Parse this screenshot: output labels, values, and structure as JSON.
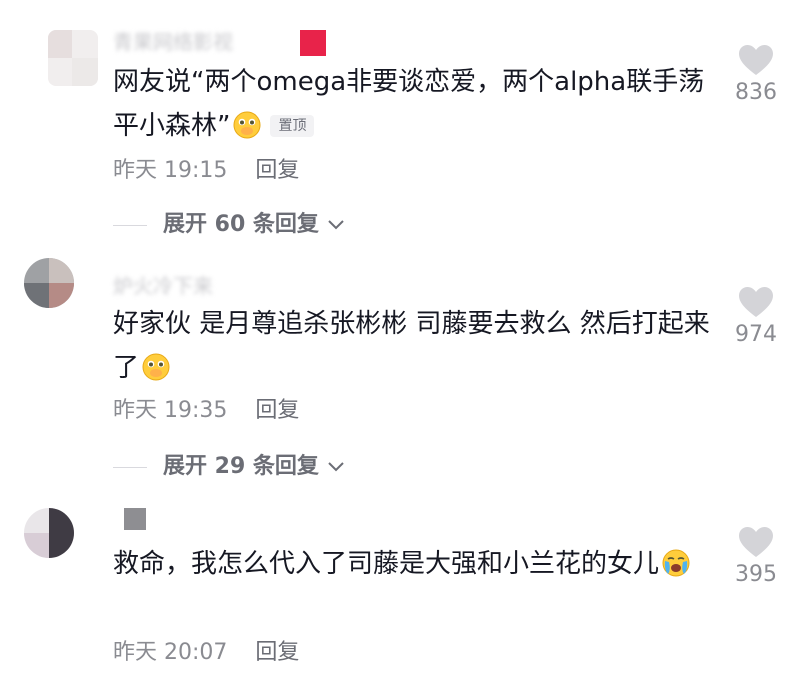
{
  "comments": [
    {
      "username": "青果网络影视",
      "text": "网友说“两个omega非要谈恋爱，两个alpha联手荡平小森林”",
      "emoji": "pleading-face-emoji",
      "pinned_label": "置顶",
      "date": "昨天 19:15",
      "reply_label": "回复",
      "expand_label": "展开 60 条回复",
      "likes": "836"
    },
    {
      "username": "炉火冷下来",
      "text": "好家伙 是月尊追杀张彬彬 司藤要去救么 然后打起来了",
      "emoji": "pleading-face-emoji",
      "date": "昨天 19:35",
      "reply_label": "回复",
      "expand_label": "展开 29 条回复",
      "likes": "974"
    },
    {
      "username": "",
      "text": "救命，我怎么代入了司藤是大强和小兰花的女儿",
      "emoji": "crying-face-emoji",
      "date": "昨天 20:07",
      "reply_label": "回复",
      "likes": "395"
    }
  ],
  "colors": {
    "text": "#161823",
    "meta": "#8a8b91",
    "heart": "#d4d4d8",
    "pin_badge_bg": "#f2f2f4"
  }
}
